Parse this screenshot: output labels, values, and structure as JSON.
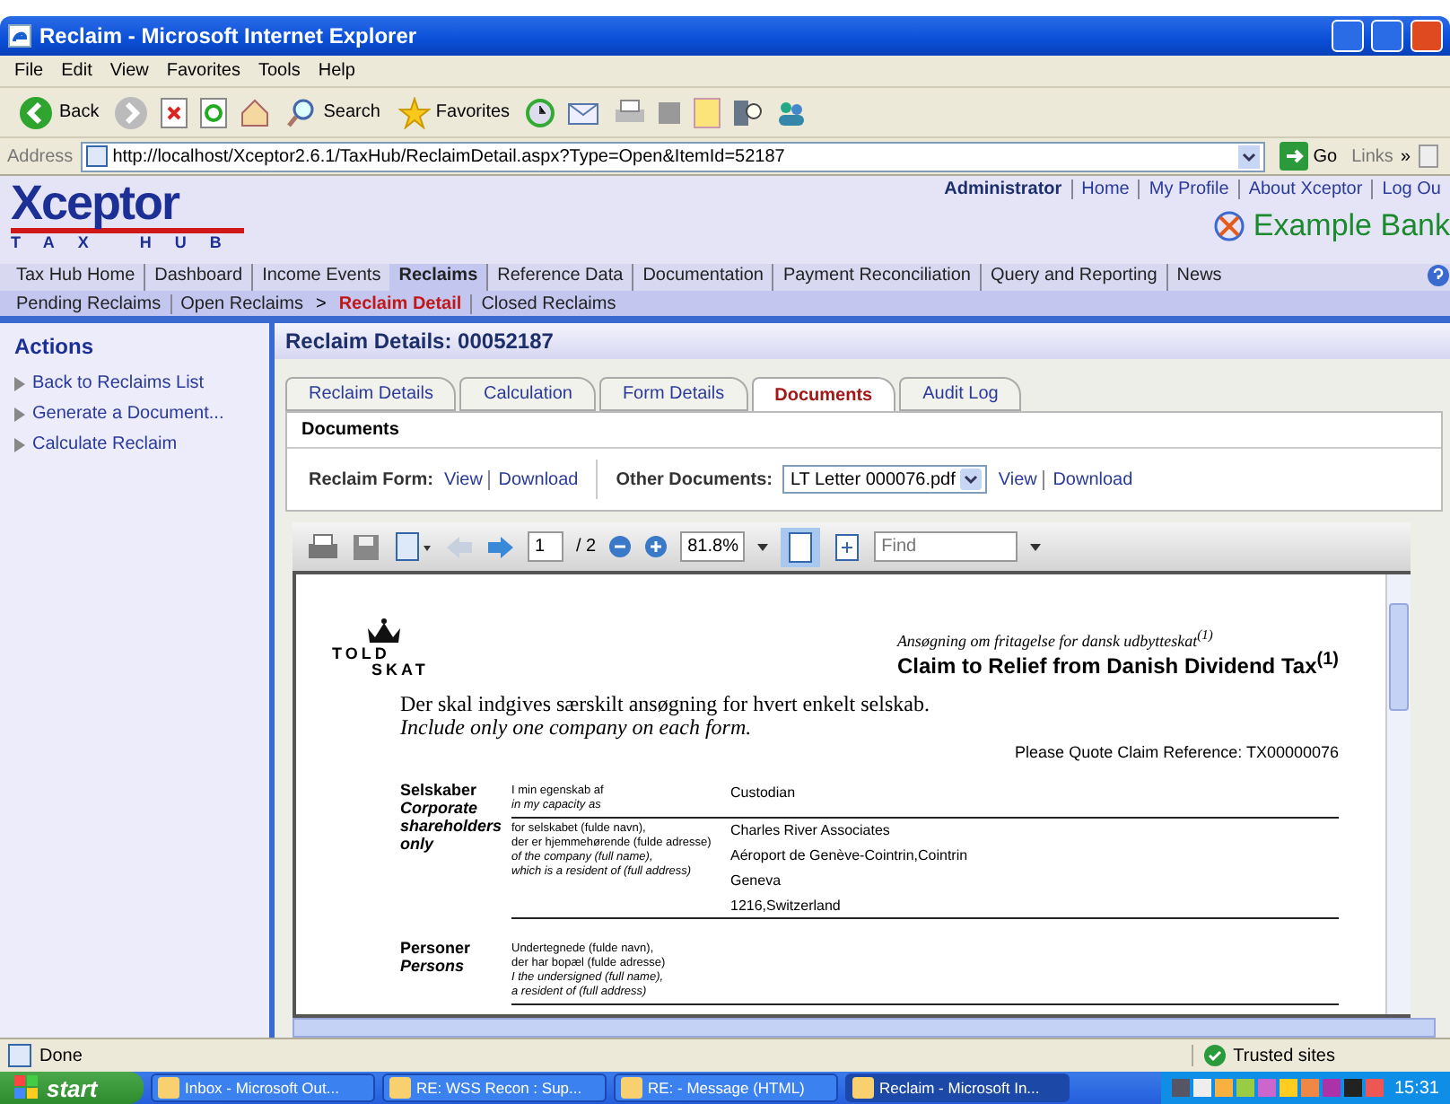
{
  "window": {
    "title": "Reclaim - Microsoft Internet Explorer"
  },
  "menu": [
    "File",
    "Edit",
    "View",
    "Favorites",
    "Tools",
    "Help"
  ],
  "toolbar": {
    "back": "Back",
    "search": "Search",
    "favorites": "Favorites"
  },
  "address": {
    "label": "Address",
    "value": "http://localhost/Xceptor2.6.1/TaxHub/ReclaimDetail.aspx?Type=Open&ItemId=52187",
    "go": "Go",
    "links": "Links",
    "more": "»"
  },
  "header": {
    "logo": "Xceptor",
    "logo_sub": "TAX HUB",
    "user": "Administrator",
    "links": [
      "Home",
      "My Profile",
      "About Xceptor",
      "Log Ou"
    ],
    "bank": "Example Bank"
  },
  "nav": [
    {
      "label": "Tax Hub Home",
      "selected": false
    },
    {
      "label": "Dashboard",
      "selected": false
    },
    {
      "label": "Income Events",
      "selected": false
    },
    {
      "label": "Reclaims",
      "selected": true
    },
    {
      "label": "Reference Data",
      "selected": false
    },
    {
      "label": "Documentation",
      "selected": false
    },
    {
      "label": "Payment Reconciliation",
      "selected": false
    },
    {
      "label": "Query and Reporting",
      "selected": false
    },
    {
      "label": "News",
      "selected": false
    }
  ],
  "subnav": [
    {
      "kind": "link",
      "label": "Pending Reclaims"
    },
    {
      "kind": "link",
      "label": "Open Reclaims"
    },
    {
      "kind": "arrow",
      "label": ">"
    },
    {
      "kind": "current",
      "label": "Reclaim Detail"
    },
    {
      "kind": "link",
      "label": "Closed Reclaims"
    }
  ],
  "sidebar": {
    "title": "Actions",
    "items": [
      "Back to Reclaims List",
      "Generate a Document...",
      "Calculate Reclaim"
    ]
  },
  "detail": {
    "title": "Reclaim Details: 00052187",
    "tabs": [
      {
        "label": "Reclaim Details",
        "selected": false
      },
      {
        "label": "Calculation",
        "selected": false
      },
      {
        "label": "Form Details",
        "selected": false
      },
      {
        "label": "Documents",
        "selected": true
      },
      {
        "label": "Audit Log",
        "selected": false
      }
    ],
    "documents": {
      "title": "Documents",
      "form_label": "Reclaim Form:",
      "form_links": [
        "View",
        "Download"
      ],
      "other_label": "Other Documents:",
      "selected_file": "LT Letter 000076.pdf",
      "other_links": [
        "View",
        "Download"
      ]
    }
  },
  "viewer": {
    "page": "1",
    "page_count": "/ 2",
    "zoom": "81.8%",
    "find_placeholder": "Find",
    "doc": {
      "logo_top": "TOLD",
      "logo_bottom": "SKAT",
      "subtitle": "Ansøgning om fritagelse for dansk udbytteskat$^{(1)}$",
      "title": "Claim to Relief from Danish Dividend Tax$^{(1)}$",
      "intro": "Der skal indgives særskilt ansøgning for hvert enkelt selskab.",
      "intro_en": "Include only one company on each form.",
      "reference": "Please Quote Claim Reference: TX00000076",
      "sections": [
        {
          "heading": "Selskaber",
          "heading_en": "Corporate shareholders only",
          "rows": [
            {
              "notes": [
                "I min egenskab af"
              ],
              "notes_en": [
                "in my capacity as"
              ],
              "values": [
                "Custodian"
              ]
            },
            {
              "notes": [
                "for selskabet (fulde navn),",
                "der er hjemmehørende (fulde adresse)"
              ],
              "notes_en": [
                "of the company (full name),",
                "which is a resident of (full address)"
              ],
              "values": [
                "Charles River Associates",
                "Aéroport de Genève-Cointrin,Cointrin",
                "Geneva",
                "1216,Switzerland"
              ]
            }
          ]
        },
        {
          "heading": "Personer",
          "heading_en": "Persons",
          "rows": [
            {
              "notes": [
                "Undertegnede (fulde navn),",
                "der har bopæl (fulde adresse)"
              ],
              "notes_en": [
                "I the undersigned (full name),",
                "a resident of (full address)"
              ]
            }
          ]
        }
      ]
    }
  },
  "status": {
    "text": "Done",
    "zone": "Trusted sites"
  },
  "taskbar": {
    "start": "start",
    "tasks": [
      {
        "label": "Inbox - Microsoft Out...",
        "selected": false
      },
      {
        "label": "RE: WSS Recon : Sup...",
        "selected": false
      },
      {
        "label": "RE:  - Message (HTML)",
        "selected": false
      },
      {
        "label": "Reclaim - Microsoft In...",
        "selected": true
      }
    ],
    "clock": "15:31"
  }
}
